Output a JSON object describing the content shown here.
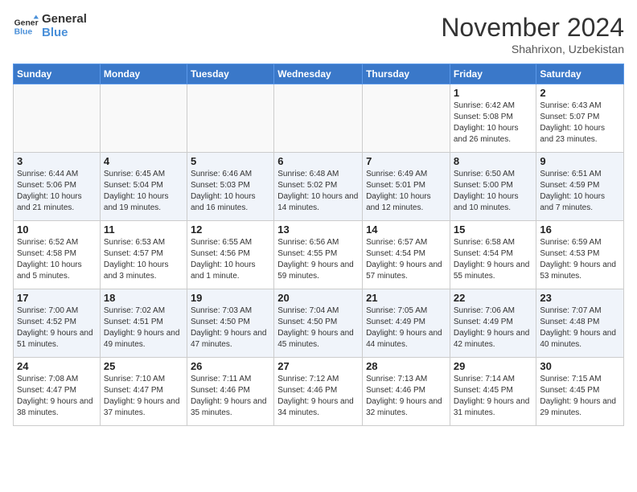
{
  "header": {
    "logo_line1": "General",
    "logo_line2": "Blue",
    "month": "November 2024",
    "location": "Shahrixon, Uzbekistan"
  },
  "weekdays": [
    "Sunday",
    "Monday",
    "Tuesday",
    "Wednesday",
    "Thursday",
    "Friday",
    "Saturday"
  ],
  "weeks": [
    [
      {
        "day": "",
        "info": ""
      },
      {
        "day": "",
        "info": ""
      },
      {
        "day": "",
        "info": ""
      },
      {
        "day": "",
        "info": ""
      },
      {
        "day": "",
        "info": ""
      },
      {
        "day": "1",
        "info": "Sunrise: 6:42 AM\nSunset: 5:08 PM\nDaylight: 10 hours and 26 minutes."
      },
      {
        "day": "2",
        "info": "Sunrise: 6:43 AM\nSunset: 5:07 PM\nDaylight: 10 hours and 23 minutes."
      }
    ],
    [
      {
        "day": "3",
        "info": "Sunrise: 6:44 AM\nSunset: 5:06 PM\nDaylight: 10 hours and 21 minutes."
      },
      {
        "day": "4",
        "info": "Sunrise: 6:45 AM\nSunset: 5:04 PM\nDaylight: 10 hours and 19 minutes."
      },
      {
        "day": "5",
        "info": "Sunrise: 6:46 AM\nSunset: 5:03 PM\nDaylight: 10 hours and 16 minutes."
      },
      {
        "day": "6",
        "info": "Sunrise: 6:48 AM\nSunset: 5:02 PM\nDaylight: 10 hours and 14 minutes."
      },
      {
        "day": "7",
        "info": "Sunrise: 6:49 AM\nSunset: 5:01 PM\nDaylight: 10 hours and 12 minutes."
      },
      {
        "day": "8",
        "info": "Sunrise: 6:50 AM\nSunset: 5:00 PM\nDaylight: 10 hours and 10 minutes."
      },
      {
        "day": "9",
        "info": "Sunrise: 6:51 AM\nSunset: 4:59 PM\nDaylight: 10 hours and 7 minutes."
      }
    ],
    [
      {
        "day": "10",
        "info": "Sunrise: 6:52 AM\nSunset: 4:58 PM\nDaylight: 10 hours and 5 minutes."
      },
      {
        "day": "11",
        "info": "Sunrise: 6:53 AM\nSunset: 4:57 PM\nDaylight: 10 hours and 3 minutes."
      },
      {
        "day": "12",
        "info": "Sunrise: 6:55 AM\nSunset: 4:56 PM\nDaylight: 10 hours and 1 minute."
      },
      {
        "day": "13",
        "info": "Sunrise: 6:56 AM\nSunset: 4:55 PM\nDaylight: 9 hours and 59 minutes."
      },
      {
        "day": "14",
        "info": "Sunrise: 6:57 AM\nSunset: 4:54 PM\nDaylight: 9 hours and 57 minutes."
      },
      {
        "day": "15",
        "info": "Sunrise: 6:58 AM\nSunset: 4:54 PM\nDaylight: 9 hours and 55 minutes."
      },
      {
        "day": "16",
        "info": "Sunrise: 6:59 AM\nSunset: 4:53 PM\nDaylight: 9 hours and 53 minutes."
      }
    ],
    [
      {
        "day": "17",
        "info": "Sunrise: 7:00 AM\nSunset: 4:52 PM\nDaylight: 9 hours and 51 minutes."
      },
      {
        "day": "18",
        "info": "Sunrise: 7:02 AM\nSunset: 4:51 PM\nDaylight: 9 hours and 49 minutes."
      },
      {
        "day": "19",
        "info": "Sunrise: 7:03 AM\nSunset: 4:50 PM\nDaylight: 9 hours and 47 minutes."
      },
      {
        "day": "20",
        "info": "Sunrise: 7:04 AM\nSunset: 4:50 PM\nDaylight: 9 hours and 45 minutes."
      },
      {
        "day": "21",
        "info": "Sunrise: 7:05 AM\nSunset: 4:49 PM\nDaylight: 9 hours and 44 minutes."
      },
      {
        "day": "22",
        "info": "Sunrise: 7:06 AM\nSunset: 4:49 PM\nDaylight: 9 hours and 42 minutes."
      },
      {
        "day": "23",
        "info": "Sunrise: 7:07 AM\nSunset: 4:48 PM\nDaylight: 9 hours and 40 minutes."
      }
    ],
    [
      {
        "day": "24",
        "info": "Sunrise: 7:08 AM\nSunset: 4:47 PM\nDaylight: 9 hours and 38 minutes."
      },
      {
        "day": "25",
        "info": "Sunrise: 7:10 AM\nSunset: 4:47 PM\nDaylight: 9 hours and 37 minutes."
      },
      {
        "day": "26",
        "info": "Sunrise: 7:11 AM\nSunset: 4:46 PM\nDaylight: 9 hours and 35 minutes."
      },
      {
        "day": "27",
        "info": "Sunrise: 7:12 AM\nSunset: 4:46 PM\nDaylight: 9 hours and 34 minutes."
      },
      {
        "day": "28",
        "info": "Sunrise: 7:13 AM\nSunset: 4:46 PM\nDaylight: 9 hours and 32 minutes."
      },
      {
        "day": "29",
        "info": "Sunrise: 7:14 AM\nSunset: 4:45 PM\nDaylight: 9 hours and 31 minutes."
      },
      {
        "day": "30",
        "info": "Sunrise: 7:15 AM\nSunset: 4:45 PM\nDaylight: 9 hours and 29 minutes."
      }
    ]
  ]
}
